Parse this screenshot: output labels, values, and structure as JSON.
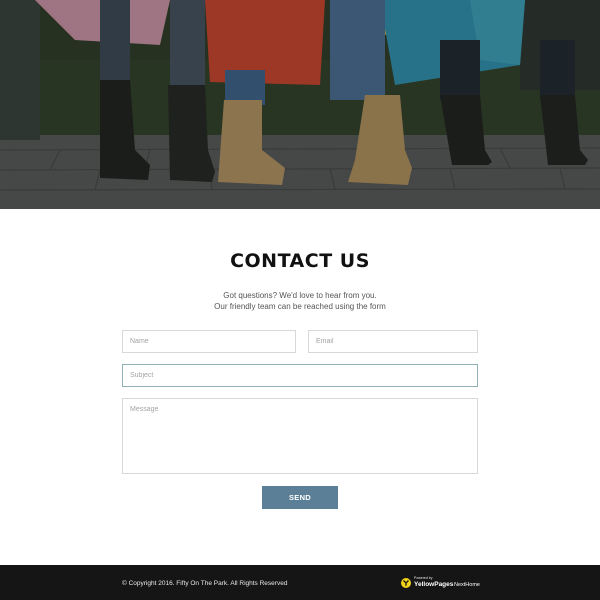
{
  "hero": {
    "image_description": "",
    "colors": {
      "overlay": "#1b1f1b",
      "paving": "#6a6b6b",
      "boot_tan": "#c9a26c",
      "boot_black": "#1c1c1c",
      "bag_red": "#e2452b",
      "bag_pink": "#e9a4bc",
      "bag_teal": "#2f9fc4",
      "bag_yellow": "#e5c545"
    }
  },
  "contact": {
    "title": "CONTACT US",
    "subtitle_line1": "Got questions? We'd love to hear from you.",
    "subtitle_line2": "Our friendly team can be reached using the form"
  },
  "form": {
    "name_placeholder": "Name",
    "email_placeholder": "Email",
    "subject_placeholder": "Subject",
    "message_placeholder": "Message",
    "name_value": "",
    "email_value": "",
    "subject_value": "",
    "message_value": "",
    "send_label": "SEND",
    "button_color": "#5b7f96",
    "focus_border_color": "#8fb0b6"
  },
  "footer": {
    "copyright": "© Copyright 2016. Fifty On The Park. All Rights Reserved",
    "powered_by": "Powered by",
    "brand": "YellowPages",
    "brand_suffix": "NextHome",
    "background_color": "#151515",
    "logo_color": "#f3d21a"
  }
}
